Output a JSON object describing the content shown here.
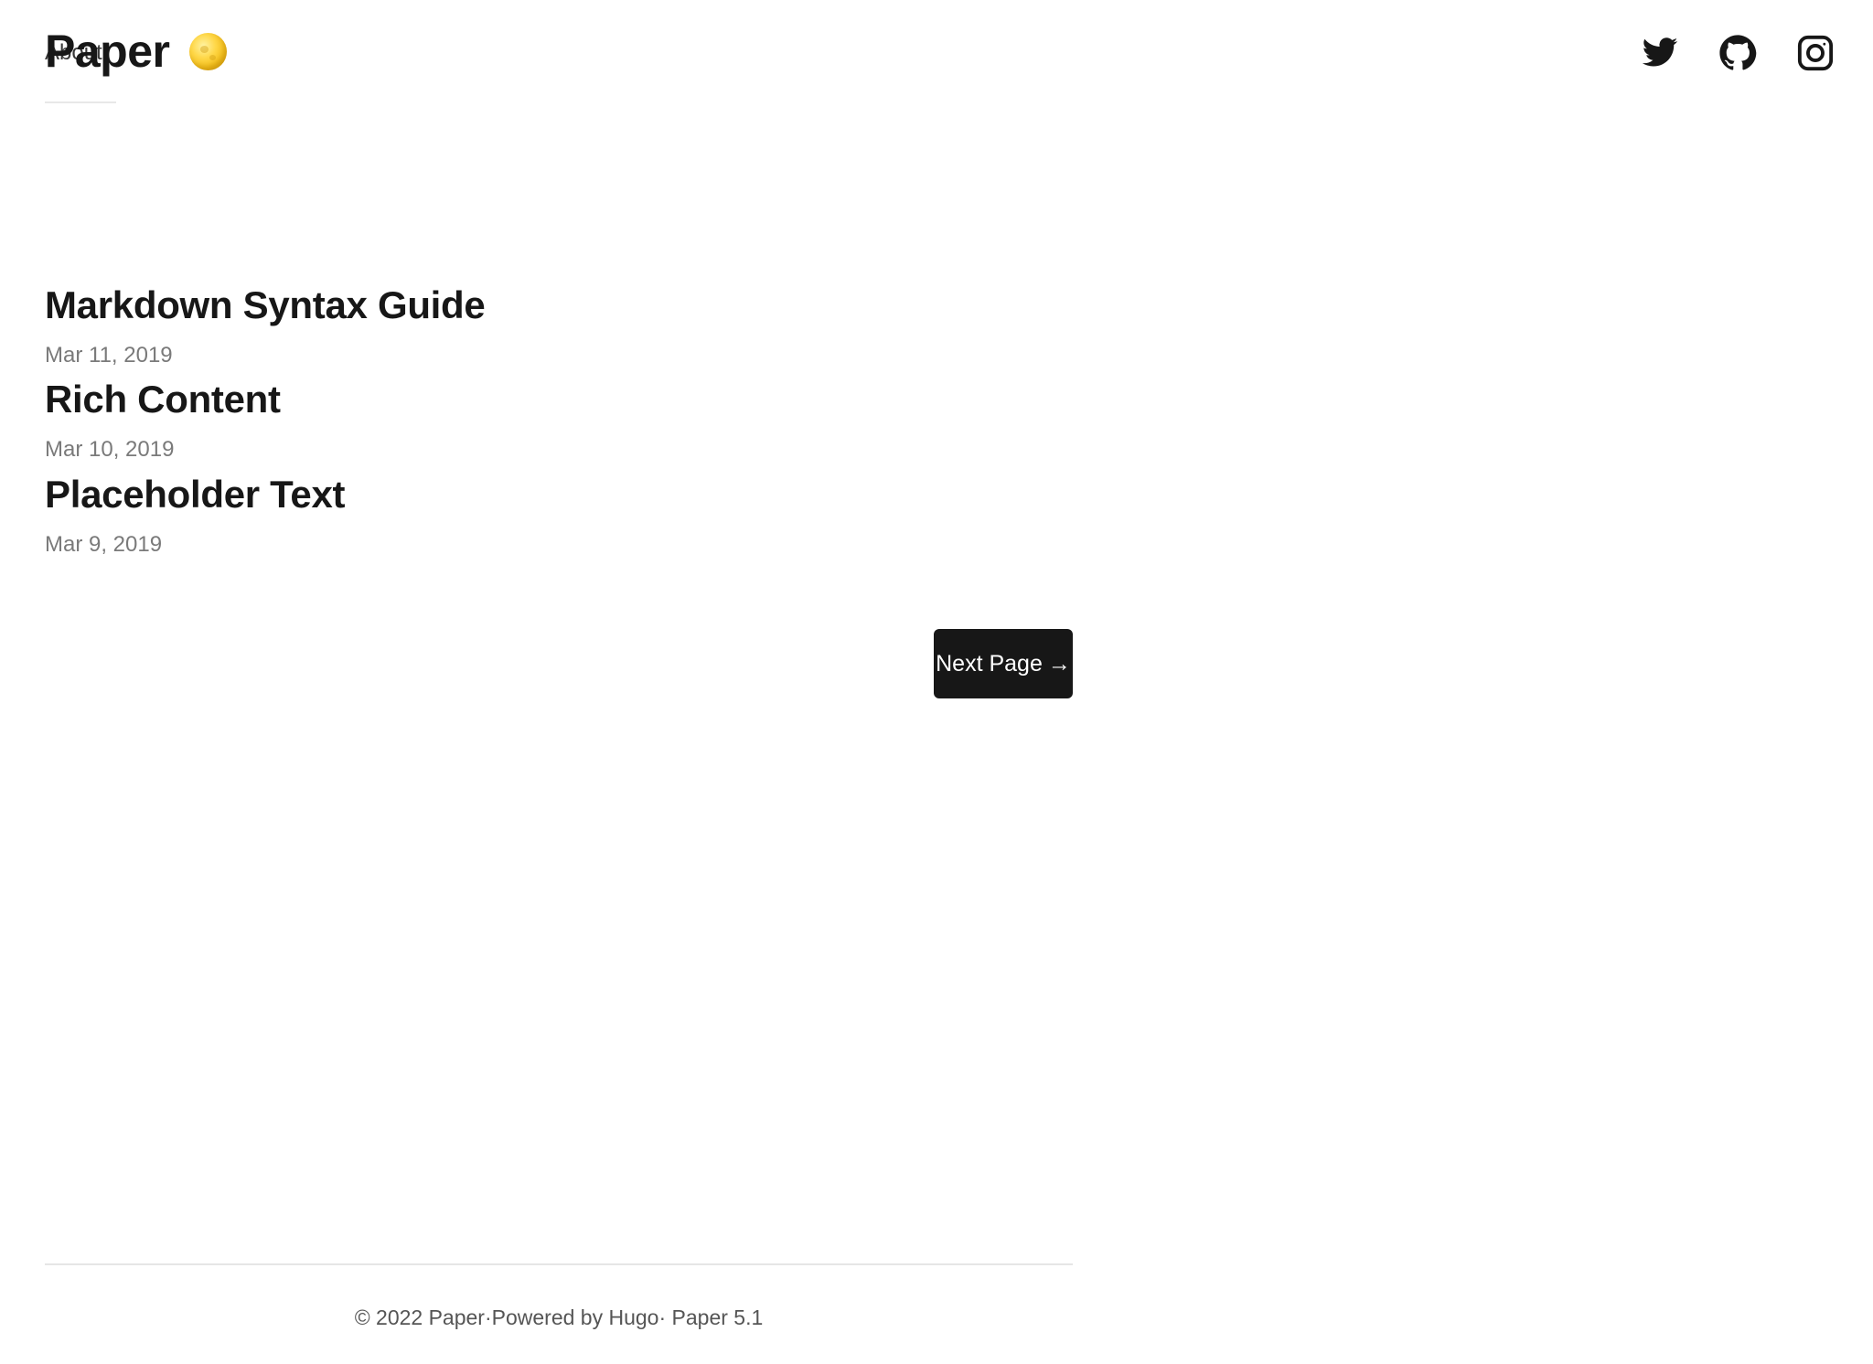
{
  "header": {
    "logo": "Paper",
    "nav_about": "About",
    "theme_toggle_icon": "moon-icon",
    "social": [
      {
        "name": "Twitter",
        "icon": "twitter-icon"
      },
      {
        "name": "GitHub",
        "icon": "github-icon"
      },
      {
        "name": "Instagram",
        "icon": "instagram-icon"
      }
    ]
  },
  "posts": [
    {
      "title": "Markdown Syntax Guide",
      "date": "Mar 11, 2019"
    },
    {
      "title": "Rich Content",
      "date": "Mar 10, 2019"
    },
    {
      "title": "Placeholder Text",
      "date": "Mar 9, 2019"
    }
  ],
  "pagination": {
    "next_label": "Next Page",
    "next_arrow": "→"
  },
  "footer": {
    "copyright": "© 2022 Paper",
    "separator_1": "·",
    "powered_by": "Powered by Hugo",
    "separator_2": "·",
    "theme": " Paper 5.1"
  },
  "colors": {
    "text": "#171717",
    "muted": "#7a7a7a",
    "button_bg": "#171717",
    "button_text": "#ffffff",
    "background": "#ffffff"
  }
}
